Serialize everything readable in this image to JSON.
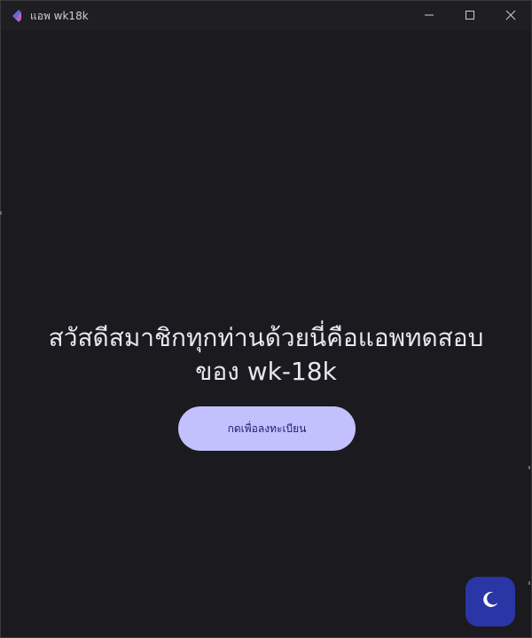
{
  "window": {
    "title": "แอพ wk18k",
    "controls": {
      "minimize_icon": "minimize-icon",
      "maximize_icon": "maximize-icon",
      "close_icon": "close-icon"
    }
  },
  "main": {
    "greeting": "สวัสดีสมาชิกทุกท่านด้วยนี่คือแอพทดสอบ\nของ wk-18k",
    "register_button_label": "กดเพื่อลงทะเบียน"
  },
  "theme_toggle": {
    "icon": "moon-icon"
  },
  "colors": {
    "background": "#1b1a1f",
    "titlebar": "#1f1e23",
    "button_bg": "#c2c1fd",
    "button_text": "#1b1e6b",
    "fab_bg": "#2a35a6",
    "text": "#e8e6ee"
  }
}
